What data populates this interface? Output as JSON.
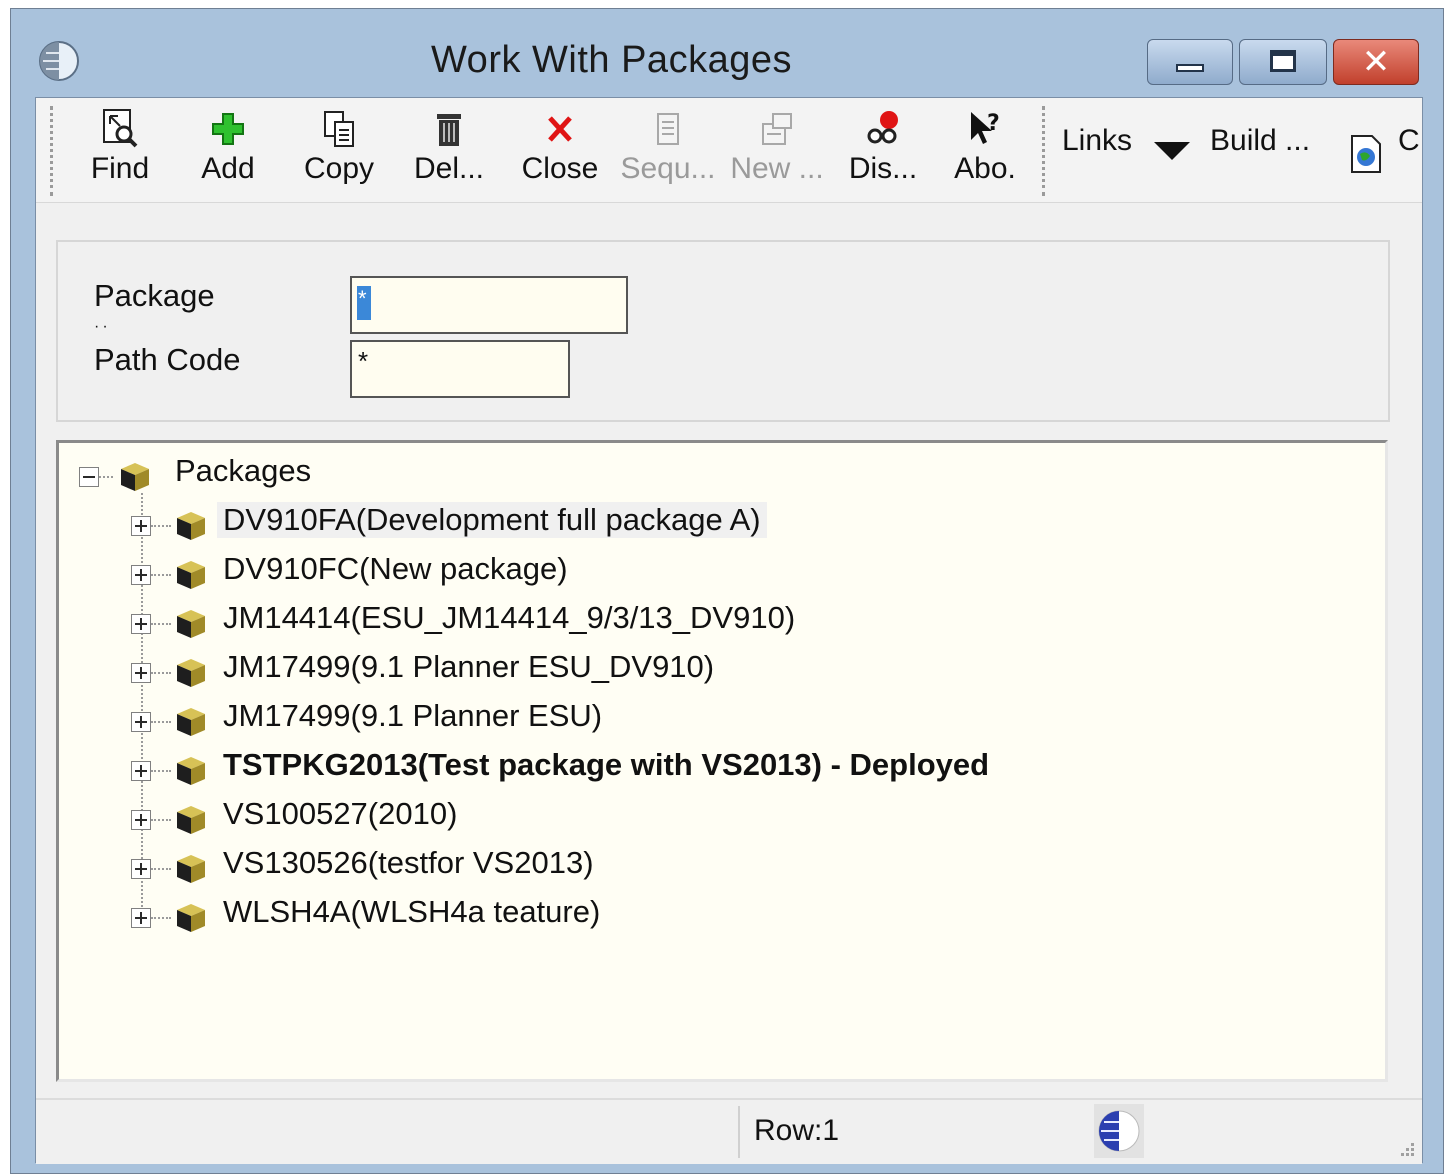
{
  "window": {
    "title": "Work With Packages",
    "icons": {
      "app": "jde-globe-icon",
      "minimize": "minimize-icon",
      "maximize": "maximize-icon",
      "close": "close-icon"
    },
    "close_glyph": "✕"
  },
  "toolbar": {
    "buttons": [
      {
        "label": "Find",
        "icon": "find-icon",
        "enabled": true
      },
      {
        "label": "Add",
        "icon": "add-icon",
        "enabled": true
      },
      {
        "label": "Copy",
        "icon": "copy-icon",
        "enabled": true
      },
      {
        "label": "Del...",
        "icon": "delete-icon",
        "enabled": true
      },
      {
        "label": "Close",
        "icon": "close-x-icon",
        "enabled": true
      },
      {
        "label": "Sequ...",
        "icon": "sequence-icon",
        "enabled": false
      },
      {
        "label": "New ...",
        "icon": "new-icon",
        "enabled": false
      },
      {
        "label": "Dis...",
        "icon": "display-icon",
        "enabled": true
      },
      {
        "label": "Abo.",
        "icon": "about-help-icon",
        "enabled": true
      }
    ],
    "links_label": "Links",
    "build_label": "Build ...",
    "overflow_label": "C",
    "overflow_icon": "document-globe-icon"
  },
  "criteria": {
    "package_label": "Package",
    "package_value": "*",
    "path_code_label": "Path Code",
    "path_code_value": "*"
  },
  "tree": {
    "root_label": "Packages",
    "items": [
      {
        "label": "DV910FA(Development full package A)",
        "bold": false,
        "selected": true
      },
      {
        "label": "DV910FC(New package)",
        "bold": false,
        "selected": false
      },
      {
        "label": "JM14414(ESU_JM14414_9/3/13_DV910)",
        "bold": false,
        "selected": false
      },
      {
        "label": "JM17499(9.1 Planner ESU_DV910)",
        "bold": false,
        "selected": false
      },
      {
        "label": "JM17499(9.1 Planner ESU)",
        "bold": false,
        "selected": false
      },
      {
        "label": "TSTPKG2013(Test package with VS2013) - Deployed",
        "bold": true,
        "selected": false
      },
      {
        "label": "VS100527(2010)",
        "bold": false,
        "selected": false
      },
      {
        "label": "VS130526(testfor VS2013)",
        "bold": false,
        "selected": false
      },
      {
        "label": "WLSH4A(WLSH4a teature)",
        "bold": false,
        "selected": false
      }
    ]
  },
  "status": {
    "row_text": "Row:1",
    "icon": "jde-globe-icon"
  }
}
